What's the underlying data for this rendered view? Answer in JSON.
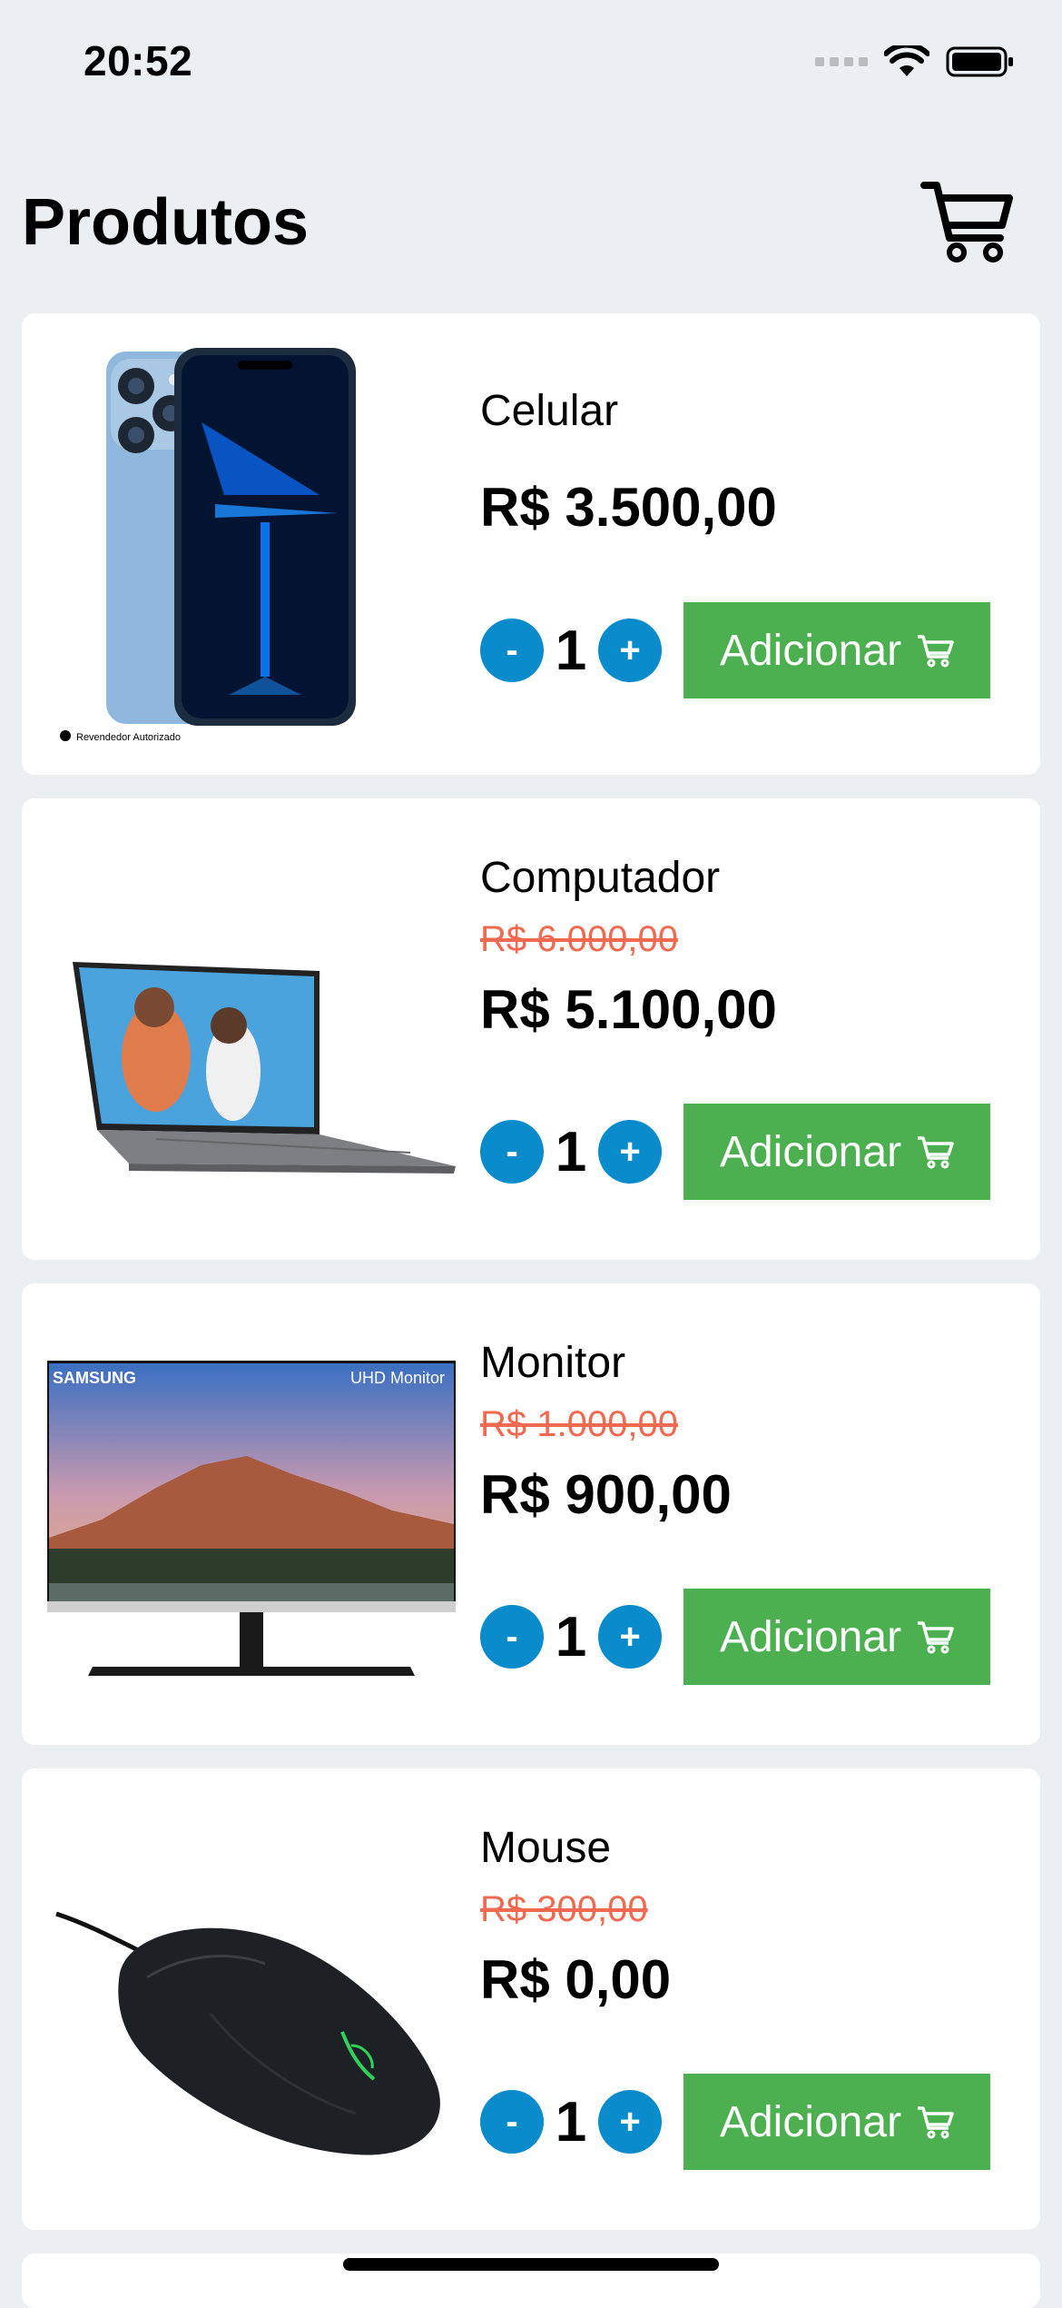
{
  "status": {
    "time": "20:52"
  },
  "header": {
    "title": "Produtos"
  },
  "colors": {
    "accent_blue": "#0a8ccc",
    "add_green": "#4caf50",
    "old_price_red": "#ef6a50",
    "background": "#eceff1"
  },
  "products": [
    {
      "name": "Celular",
      "old_price": "",
      "price": "R$ 3.500,00",
      "quantity": "1",
      "decrement": "-",
      "increment": "+",
      "add_label": "Adicionar",
      "image_caption": "Revendedor Autorizado"
    },
    {
      "name": "Computador",
      "old_price": "R$ 6.000,00",
      "price": "R$ 5.100,00",
      "quantity": "1",
      "decrement": "-",
      "increment": "+",
      "add_label": "Adicionar"
    },
    {
      "name": "Monitor",
      "old_price": "R$ 1.000,00",
      "price": "R$ 900,00",
      "quantity": "1",
      "decrement": "-",
      "increment": "+",
      "add_label": "Adicionar",
      "image_brand": "SAMSUNG",
      "image_model": "UHD Monitor"
    },
    {
      "name": "Mouse",
      "old_price": "R$ 300,00",
      "price": "R$ 0,00",
      "quantity": "1",
      "decrement": "-",
      "increment": "+",
      "add_label": "Adicionar"
    }
  ],
  "icons": {
    "cart": "cart-icon",
    "add_cart": "cart-small-icon",
    "wifi": "wifi-icon",
    "battery": "battery-icon"
  }
}
